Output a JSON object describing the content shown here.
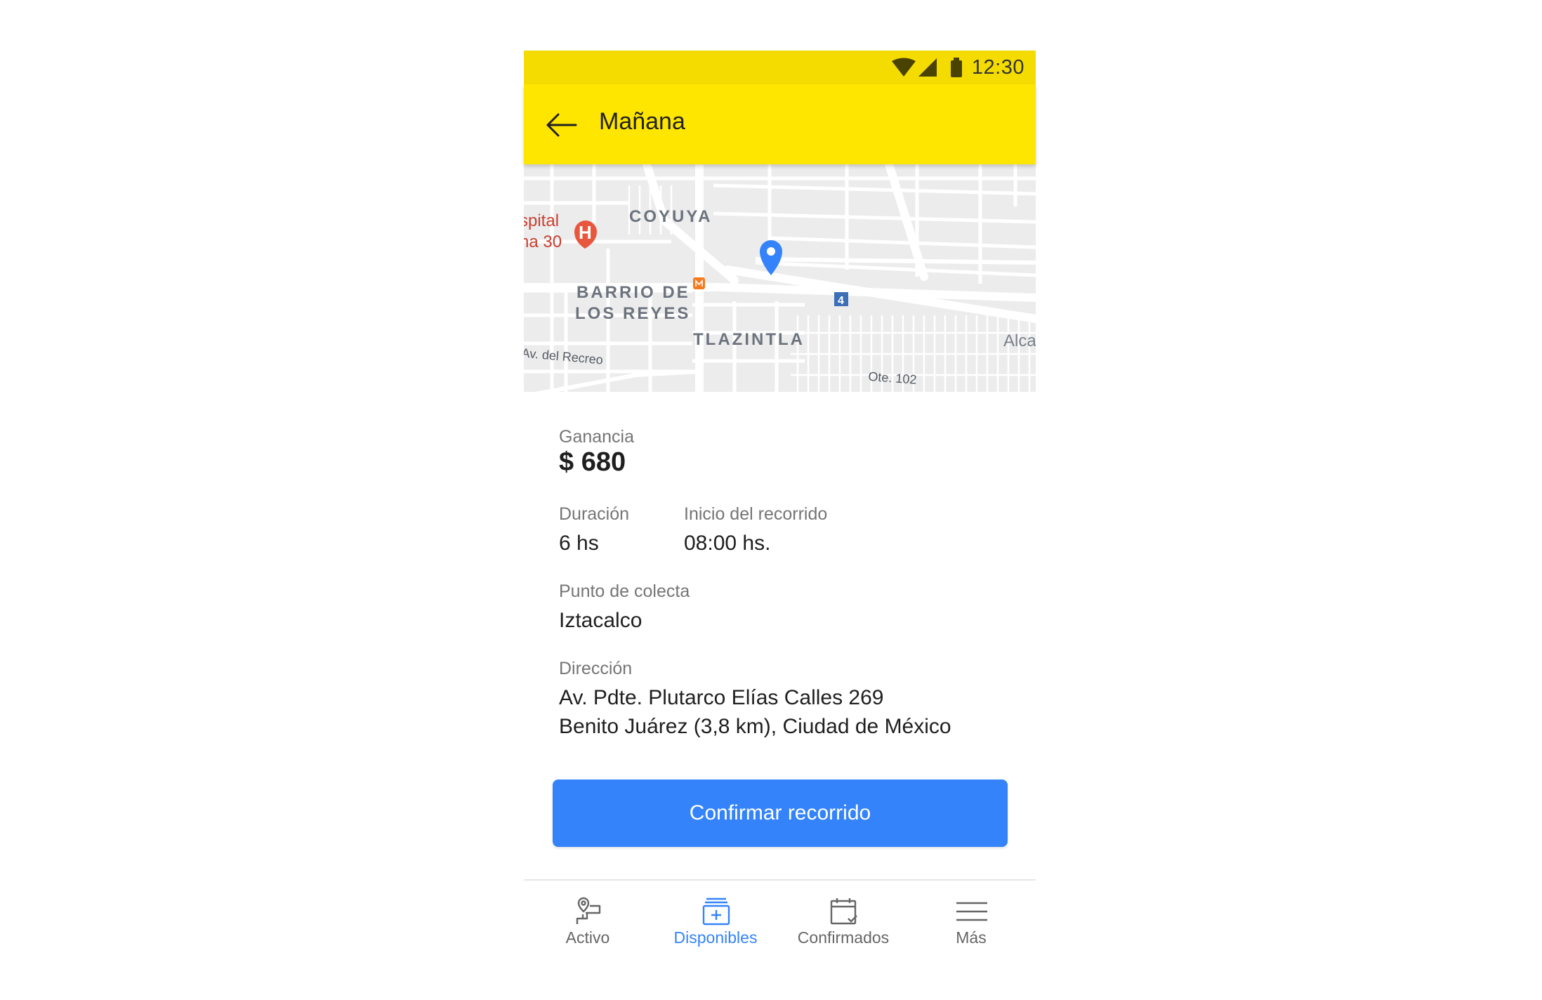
{
  "status_bar": {
    "time": "12:30"
  },
  "app_bar": {
    "title": "Mañana",
    "back_icon": "arrow-left-icon"
  },
  "map": {
    "labels": {
      "hospital_1": "spital",
      "hospital_2": "na 30",
      "coyuya": "COYUYA",
      "barrio_1": "BARRIO DE",
      "barrio_2": "LOS REYES",
      "tlazintla": "TLAZINTLA",
      "recreo": "Av. del Recreo",
      "ote": "Ote. 102",
      "alca": "Alca",
      "metro_line": "4",
      "hospital_marker": "H"
    }
  },
  "details": {
    "earnings": {
      "label": "Ganancia",
      "value": "$ 680"
    },
    "duration": {
      "label": "Duración",
      "value": "6 hs"
    },
    "start": {
      "label": "Inicio del recorrido",
      "value": "08:00 hs."
    },
    "pickup": {
      "label": "Punto de colecta",
      "value": "Iztacalco"
    },
    "address": {
      "label": "Dirección",
      "line1": "Av. Pdte. Plutarco Elías Calles 269",
      "line2": "Benito Juárez (3,8 km), Ciudad de México"
    }
  },
  "confirm_button": {
    "label": "Confirmar recorrido",
    "color": "#3483fa"
  },
  "bottom_nav": {
    "items": [
      {
        "label": "Activo",
        "icon": "map-pin-route-icon"
      },
      {
        "label": "Disponibles",
        "icon": "stacked-add-icon",
        "active": true
      },
      {
        "label": "Confirmados",
        "icon": "calendar-check-icon"
      },
      {
        "label": "Más",
        "icon": "menu-icon"
      }
    ]
  },
  "colors": {
    "brand_yellow": "#ffe600",
    "status_yellow": "#f5dc00",
    "accent_blue": "#3483fa"
  }
}
